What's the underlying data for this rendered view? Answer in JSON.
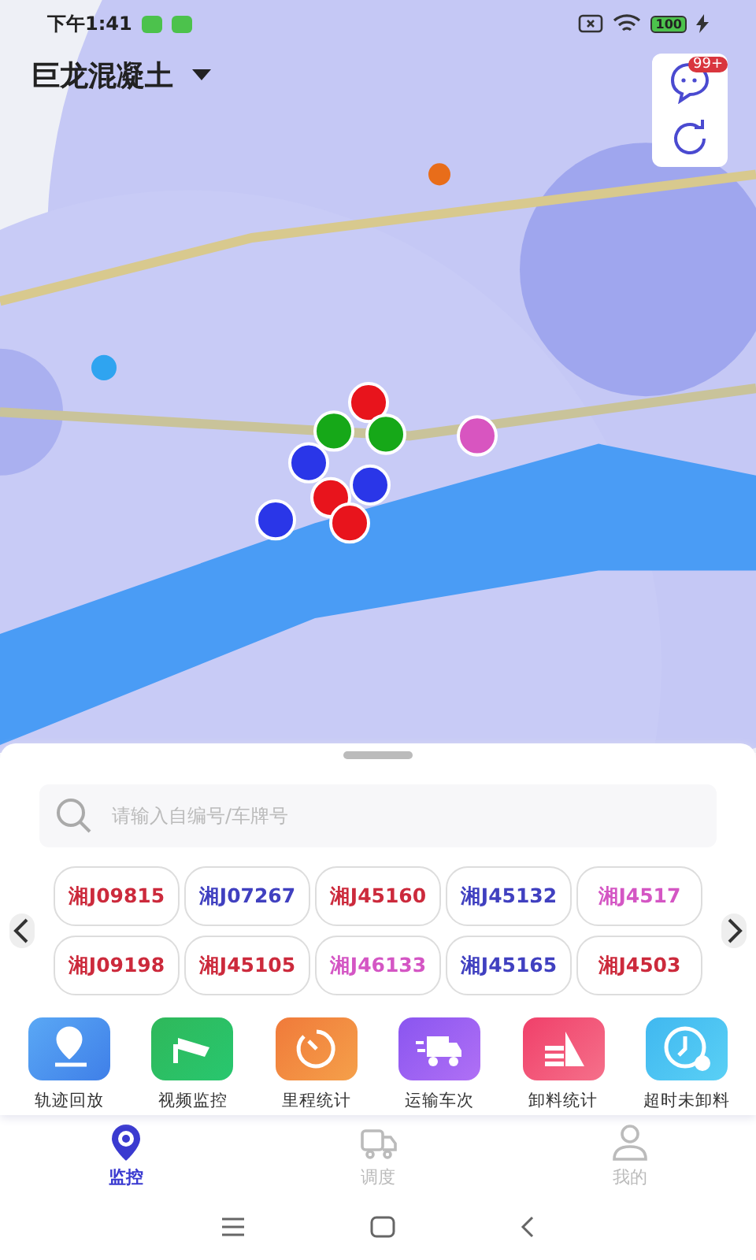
{
  "status_bar": {
    "time": "下午1:41",
    "battery": "100"
  },
  "header": {
    "title": "巨龙混凝土"
  },
  "map_tools": {
    "badge": "99+"
  },
  "search": {
    "placeholder": "请输入自编号/车牌号"
  },
  "plates": [
    {
      "text": "湘J09815",
      "color": "#cc2a3c"
    },
    {
      "text": "湘J07267",
      "color": "#4040c0"
    },
    {
      "text": "湘J45160",
      "color": "#cc2a3c"
    },
    {
      "text": "湘J45132",
      "color": "#4040c0"
    },
    {
      "text": "湘J4517",
      "color": "#d456c4"
    },
    {
      "text": "湘J09198",
      "color": "#cc2a3c"
    },
    {
      "text": "湘J45105",
      "color": "#cc2a3c"
    },
    {
      "text": "湘J46133",
      "color": "#d456c4"
    },
    {
      "text": "湘J45165",
      "color": "#4040c0"
    },
    {
      "text": "湘J4503",
      "color": "#cc2a3c"
    }
  ],
  "actions": [
    {
      "label": "轨迹回放",
      "kind": "track"
    },
    {
      "label": "视频监控",
      "kind": "camera"
    },
    {
      "label": "里程统计",
      "kind": "mileage"
    },
    {
      "label": "运输车次",
      "kind": "truck"
    },
    {
      "label": "卸料统计",
      "kind": "unload"
    },
    {
      "label": "超时未卸料",
      "kind": "overtime"
    }
  ],
  "tabs": [
    {
      "label": "监控",
      "kind": "monitor",
      "selected": true
    },
    {
      "label": "调度",
      "kind": "dispatch",
      "selected": false
    },
    {
      "label": "我的",
      "kind": "me",
      "selected": false
    }
  ]
}
